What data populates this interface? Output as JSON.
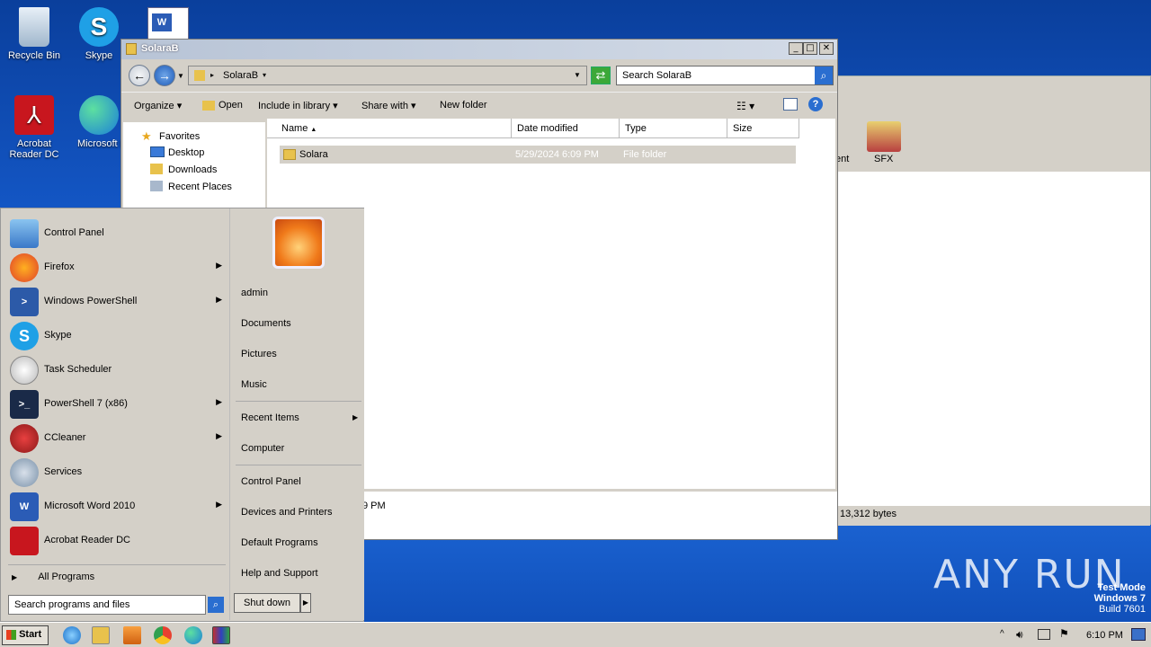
{
  "desktop": {
    "icons": [
      {
        "label": "Recycle Bin"
      },
      {
        "label": "Skype"
      },
      {
        "label": "Acrobat Reader DC"
      },
      {
        "label": "Microsoft Edge"
      }
    ]
  },
  "explorer": {
    "title": "SolaraB",
    "path": "SolaraB",
    "search_placeholder": "Search SolaraB",
    "toolbar": {
      "organize": "Organize",
      "open": "Open",
      "include": "Include in library",
      "share": "Share with",
      "newfolder": "New folder"
    },
    "nav": {
      "favorites": "Favorites",
      "desktop": "Desktop",
      "downloads": "Downloads",
      "recent": "Recent Places"
    },
    "columns": {
      "name": "Name",
      "date": "Date modified",
      "type": "Type",
      "size": "Size"
    },
    "rows": [
      {
        "name": "Solara",
        "date": "5/29/2024 6:09 PM",
        "type": "File folder",
        "size": ""
      }
    ],
    "details_partial": "9 PM"
  },
  "bgwindow": {
    "item1": "ent",
    "item2": "SFX",
    "status": "13,312 bytes"
  },
  "startmenu": {
    "programs": [
      {
        "label": "Control Panel",
        "arrow": false
      },
      {
        "label": "Firefox",
        "arrow": true
      },
      {
        "label": "Windows PowerShell",
        "arrow": true
      },
      {
        "label": "Skype",
        "arrow": false
      },
      {
        "label": "Task Scheduler",
        "arrow": false
      },
      {
        "label": "PowerShell 7 (x86)",
        "arrow": true
      },
      {
        "label": "CCleaner",
        "arrow": true
      },
      {
        "label": "Services",
        "arrow": false
      },
      {
        "label": "Microsoft Word 2010",
        "arrow": true
      },
      {
        "label": "Acrobat Reader DC",
        "arrow": false
      }
    ],
    "all_programs": "All Programs",
    "search_placeholder": "Search programs and files",
    "right": {
      "user": "admin",
      "documents": "Documents",
      "pictures": "Pictures",
      "music": "Music",
      "recent": "Recent Items",
      "computer": "Computer",
      "control": "Control Panel",
      "devices": "Devices and Printers",
      "defaults": "Default Programs",
      "help": "Help and Support"
    },
    "shutdown": "Shut down"
  },
  "taskbar": {
    "start": "Start",
    "clock": "6:10 PM"
  },
  "watermark": {
    "brand": "ANY RUN",
    "line1": "Test Mode",
    "line2": "Windows 7",
    "line3": "Build 7601"
  }
}
